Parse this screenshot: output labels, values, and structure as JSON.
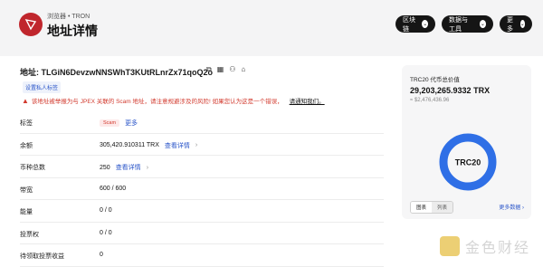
{
  "header": {
    "breadcrumb": "浏览器 • TRON",
    "title": "地址详情",
    "nav": [
      {
        "label": "区块链"
      },
      {
        "label": "数据与工具"
      },
      {
        "label": "更多"
      }
    ]
  },
  "address": {
    "label": "地址: TLGiN6DevzwNNSWhT3KUtRLnrZx71qoQ2o",
    "set_tag_label": "设置私人标签",
    "warning": "该地址被举报为与 JPEX 关联的 Scam 地址，请注意规避涉及的风险! 如果您认为这是一个错误，",
    "warning_link": "请通知我们。"
  },
  "rows": [
    {
      "key": "标签",
      "badge": "Scam",
      "link": "更多"
    },
    {
      "key": "余额",
      "value": "305,420.910311 TRX",
      "link": "查看详情",
      "suffix": "›"
    },
    {
      "key": "币种总数",
      "value": "250",
      "link": "查看详情",
      "suffix": "›"
    },
    {
      "key": "带宽",
      "value": "600 / 600"
    },
    {
      "key": "能量",
      "value": "0 / 0"
    },
    {
      "key": "投票权",
      "value": "0 / 0"
    },
    {
      "key": "待领取投票收益",
      "value": "0"
    }
  ],
  "trc20_card": {
    "label": "TRC20 代币总价值",
    "value": "29,203,265.9332 TRX",
    "usd": "≈ $2,476,436.96",
    "donut_label": "TRC20",
    "tabs": [
      "图表",
      "列表"
    ],
    "more": "更多数据",
    "ring_color": "#2f6fe6"
  },
  "watermark": "金色财经"
}
